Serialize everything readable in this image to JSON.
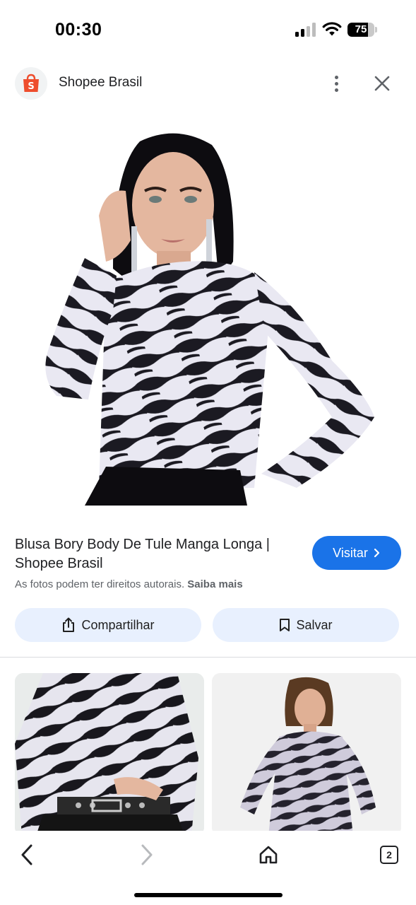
{
  "status_bar": {
    "time": "00:30",
    "battery_level": "75",
    "battery_fraction": 0.75,
    "signal_bars_active": 2,
    "signal_bars_total": 4
  },
  "header": {
    "site_name": "Shopee Brasil",
    "logo_icon": "shopee-bag-icon",
    "brand_color": "#ee4d2d"
  },
  "result": {
    "title": "Blusa Bory Body De Tule Manga Longa | Shopee Brasil",
    "visit_label": "Visitar",
    "copyright_text": "As fotos podem ter direitos autorais.",
    "learn_more_label": "Saiba mais"
  },
  "actions": {
    "share_label": "Compartilhar",
    "save_label": "Salvar"
  },
  "bottom_nav": {
    "tab_count": "2"
  },
  "colors": {
    "accent": "#1a73e8",
    "action_bg": "#e8f0fe"
  }
}
